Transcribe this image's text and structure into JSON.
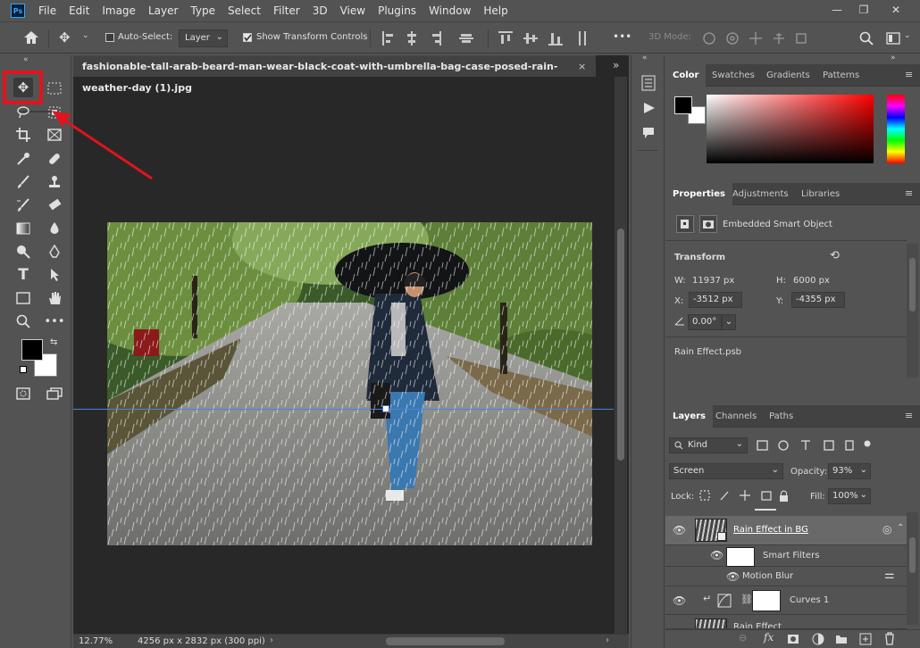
{
  "menu": [
    "File",
    "Edit",
    "Image",
    "Layer",
    "Type",
    "Select",
    "Filter",
    "3D",
    "View",
    "Plugins",
    "Window",
    "Help"
  ],
  "logo": "Ps",
  "window_controls": {
    "minimize": "—",
    "restore": "❐",
    "close": "✕"
  },
  "options": {
    "auto_select_label": "Auto-Select:",
    "auto_select_value": "Layer",
    "show_transform_label": "Show Transform Controls",
    "mode_3d_label": "3D Mode:",
    "more": "•••"
  },
  "document": {
    "tab_title": "fashionable-tall-arab-beard-man-wear-black-coat-with-umbrella-bag-case-posed-rain-weather-day (1).jpg",
    "close": "×",
    "zoom": "12.77%",
    "dimensions": "4256 px x 2832 px (300 ppi)",
    "collapse": "»"
  },
  "color_panel": {
    "tabs": [
      "Color",
      "Swatches",
      "Gradients",
      "Patterns"
    ],
    "foreground": "#000000",
    "background": "#ffffff",
    "hue": "#ff0000"
  },
  "properties_panel": {
    "tabs": [
      "Properties",
      "Adjustments",
      "Libraries"
    ],
    "object_type": "Embedded Smart Object",
    "transform_label": "Transform",
    "w_label": "W:",
    "w_value": "11937 px",
    "h_label": "H:",
    "h_value": "6000 px",
    "x_label": "X:",
    "x_value": "-3512 px",
    "y_label": "Y:",
    "y_value": "-4355 px",
    "angle_value": "0.00°",
    "linked_file": "Rain Effect.psb"
  },
  "layers_panel": {
    "tabs": [
      "Layers",
      "Channels",
      "Paths"
    ],
    "filter_kind": "Kind",
    "blend_mode": "Screen",
    "opacity_label": "Opacity:",
    "opacity_value": "93%",
    "lock_label": "Lock:",
    "fill_label": "Fill:",
    "fill_value": "100%",
    "layers": [
      {
        "name": "Rain Effect in BG"
      },
      {
        "name": "Smart Filters"
      },
      {
        "name": "Motion Blur"
      },
      {
        "name": "Curves 1"
      },
      {
        "name": "Rain Effect"
      }
    ],
    "footer_fx": "fx"
  }
}
